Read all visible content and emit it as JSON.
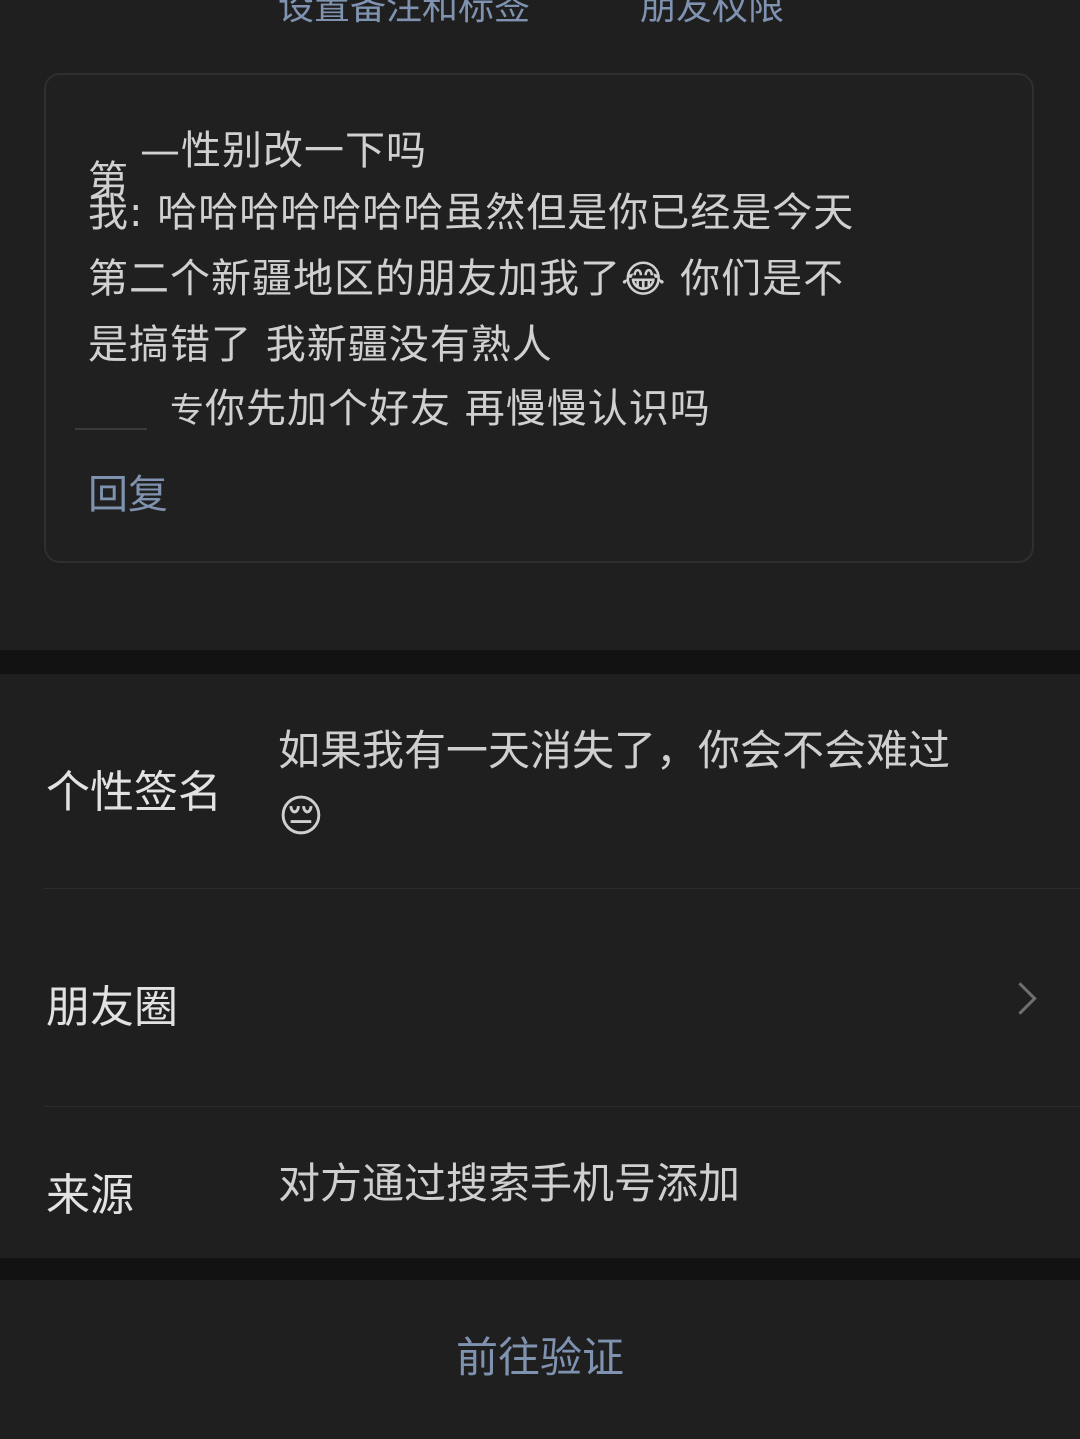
{
  "top_links": {
    "remark_label": "设置备注和标签",
    "permission_label": "朋友权限"
  },
  "chat": {
    "partial_top": "第",
    "line1_partial": "性别改一下吗",
    "line2": "我: 哈哈哈哈哈哈哈虽然但是你已经是今天",
    "line3_a": "第二个新疆地区的朋友加我了",
    "line3_emoji": "😂",
    "line3_b": " 你们是不",
    "line4": "是搞错了  我新疆没有熟人",
    "line5_prefix": "专",
    "line5": "你先加个好友  再慢慢认识吗",
    "reply_label": "回复"
  },
  "profile": {
    "signature_label": "个性签名",
    "signature_value": "如果我有一天消失了，你会不会难过",
    "signature_emoji": "😔",
    "moments_label": "朋友圈",
    "source_label": "来源",
    "source_value": "对方通过搜索手机号添加"
  },
  "footer": {
    "verify_button": "前往验证"
  }
}
